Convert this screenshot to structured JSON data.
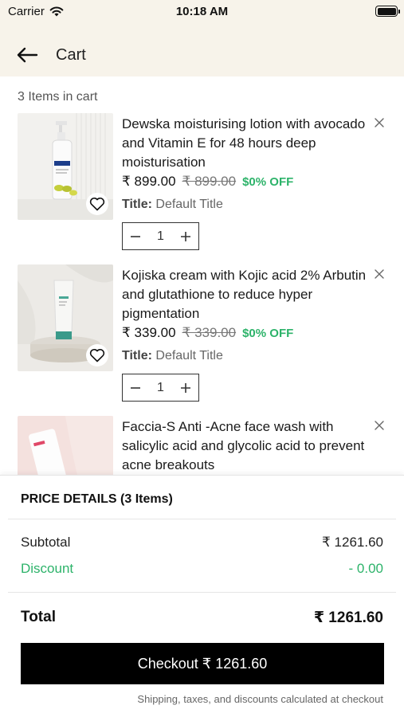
{
  "status_bar": {
    "carrier": "Carrier",
    "time": "10:18 AM"
  },
  "header": {
    "title": "Cart"
  },
  "cart": {
    "count_label": "3  Items in cart",
    "items": [
      {
        "title": "Dewska moisturising lotion with avocado and Vitamin  E for 48 hours deep moisturisation",
        "price": "₹ 899.00",
        "compare_price": "₹ 899.00",
        "discount": "$0% OFF",
        "variant_key": "Title:",
        "variant_value": " Default Title",
        "quantity": "1"
      },
      {
        "title": "Kojiska cream with Kojic acid 2% Arbutin and glutathione to reduce hyper pigmentation",
        "price": "₹ 339.00",
        "compare_price": "₹ 339.00",
        "discount": "$0% OFF",
        "variant_key": "Title:",
        "variant_value": " Default Title",
        "quantity": "1"
      },
      {
        "title": "Faccia-S Anti -Acne face wash with salicylic acid and glycolic acid to prevent acne breakouts"
      }
    ]
  },
  "price_details": {
    "title": "PRICE DETAILS (3 Items)",
    "subtotal_label": "Subtotal",
    "subtotal_value": "₹ 1261.60",
    "discount_label": "Discount",
    "discount_value": "- 0.00",
    "total_label": "Total",
    "total_value": "₹ 1261.60",
    "checkout_label": "Checkout  ₹ 1261.60",
    "note": "Shipping, taxes, and discounts calculated at checkout"
  },
  "colors": {
    "header_bg": "#f7f3ea",
    "discount_green": "#2db36a",
    "checkout_bg": "#000000"
  },
  "icons": [
    "wifi-icon",
    "battery-icon",
    "back-arrow-icon",
    "heart-icon",
    "close-icon",
    "minus-icon",
    "plus-icon"
  ]
}
